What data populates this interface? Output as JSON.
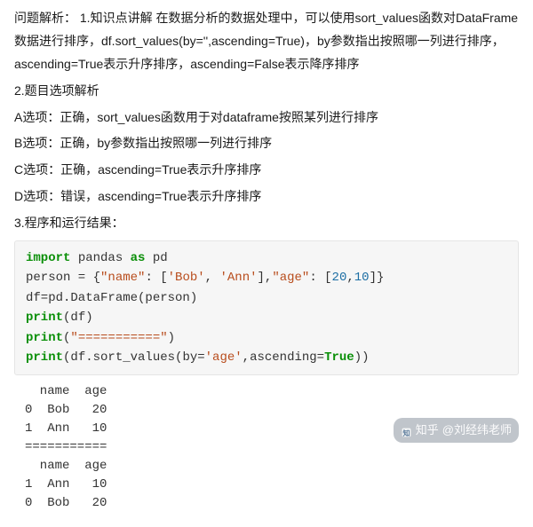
{
  "analysis": {
    "p1": "问题解析：  1.知识点讲解 在数据分析的数据处理中，可以使用sort_values函数对DataFrame数据进行排序，df.sort_values(by='',ascending=True)，by参数指出按照哪一列进行排序，ascending=True表示升序排序，ascending=False表示降序排序",
    "p2": "2.题目选项解析",
    "optA": "A选项：正确，sort_values函数用于对dataframe按照某列进行排序",
    "optB": "B选项：正确，by参数指出按照哪一列进行排序",
    "optC": "C选项：正确，ascending=True表示升序排序",
    "optD": "D选项：错误，ascending=True表示升序排序",
    "p3": "3.程序和运行结果："
  },
  "code": {
    "kw_import": "import",
    "mod_pandas": " pandas ",
    "kw_as": "as",
    "mod_pd": " pd",
    "l2a": "person = {",
    "l2_str_name": "\"name\"",
    "l2b": ": [",
    "l2_str_bob": "'Bob'",
    "l2c": ", ",
    "l2_str_ann": "'Ann'",
    "l2d": "],",
    "l2_str_age": "\"age\"",
    "l2e": ": [",
    "l2_num20": "20",
    "l2f": ",",
    "l2_num10": "10",
    "l2g": "]}",
    "l3": "df=pd.DataFrame(person)",
    "l4a": "print",
    "l4b": "(df)",
    "l5a": "print",
    "l5b": "(",
    "l5_str": "\"===========\"",
    "l5c": ")",
    "l6a": "print",
    "l6b": "(df.sort_values(by=",
    "l6_str_age": "'age'",
    "l6c": ",ascending=",
    "l6_true": "True",
    "l6d": "))"
  },
  "output_text": "  name  age\n0  Bob   20\n1  Ann   10\n===========\n  name  age\n1  Ann   10\n0  Bob   20",
  "watermark": {
    "site": "知乎",
    "author": "@刘经纬老师"
  }
}
